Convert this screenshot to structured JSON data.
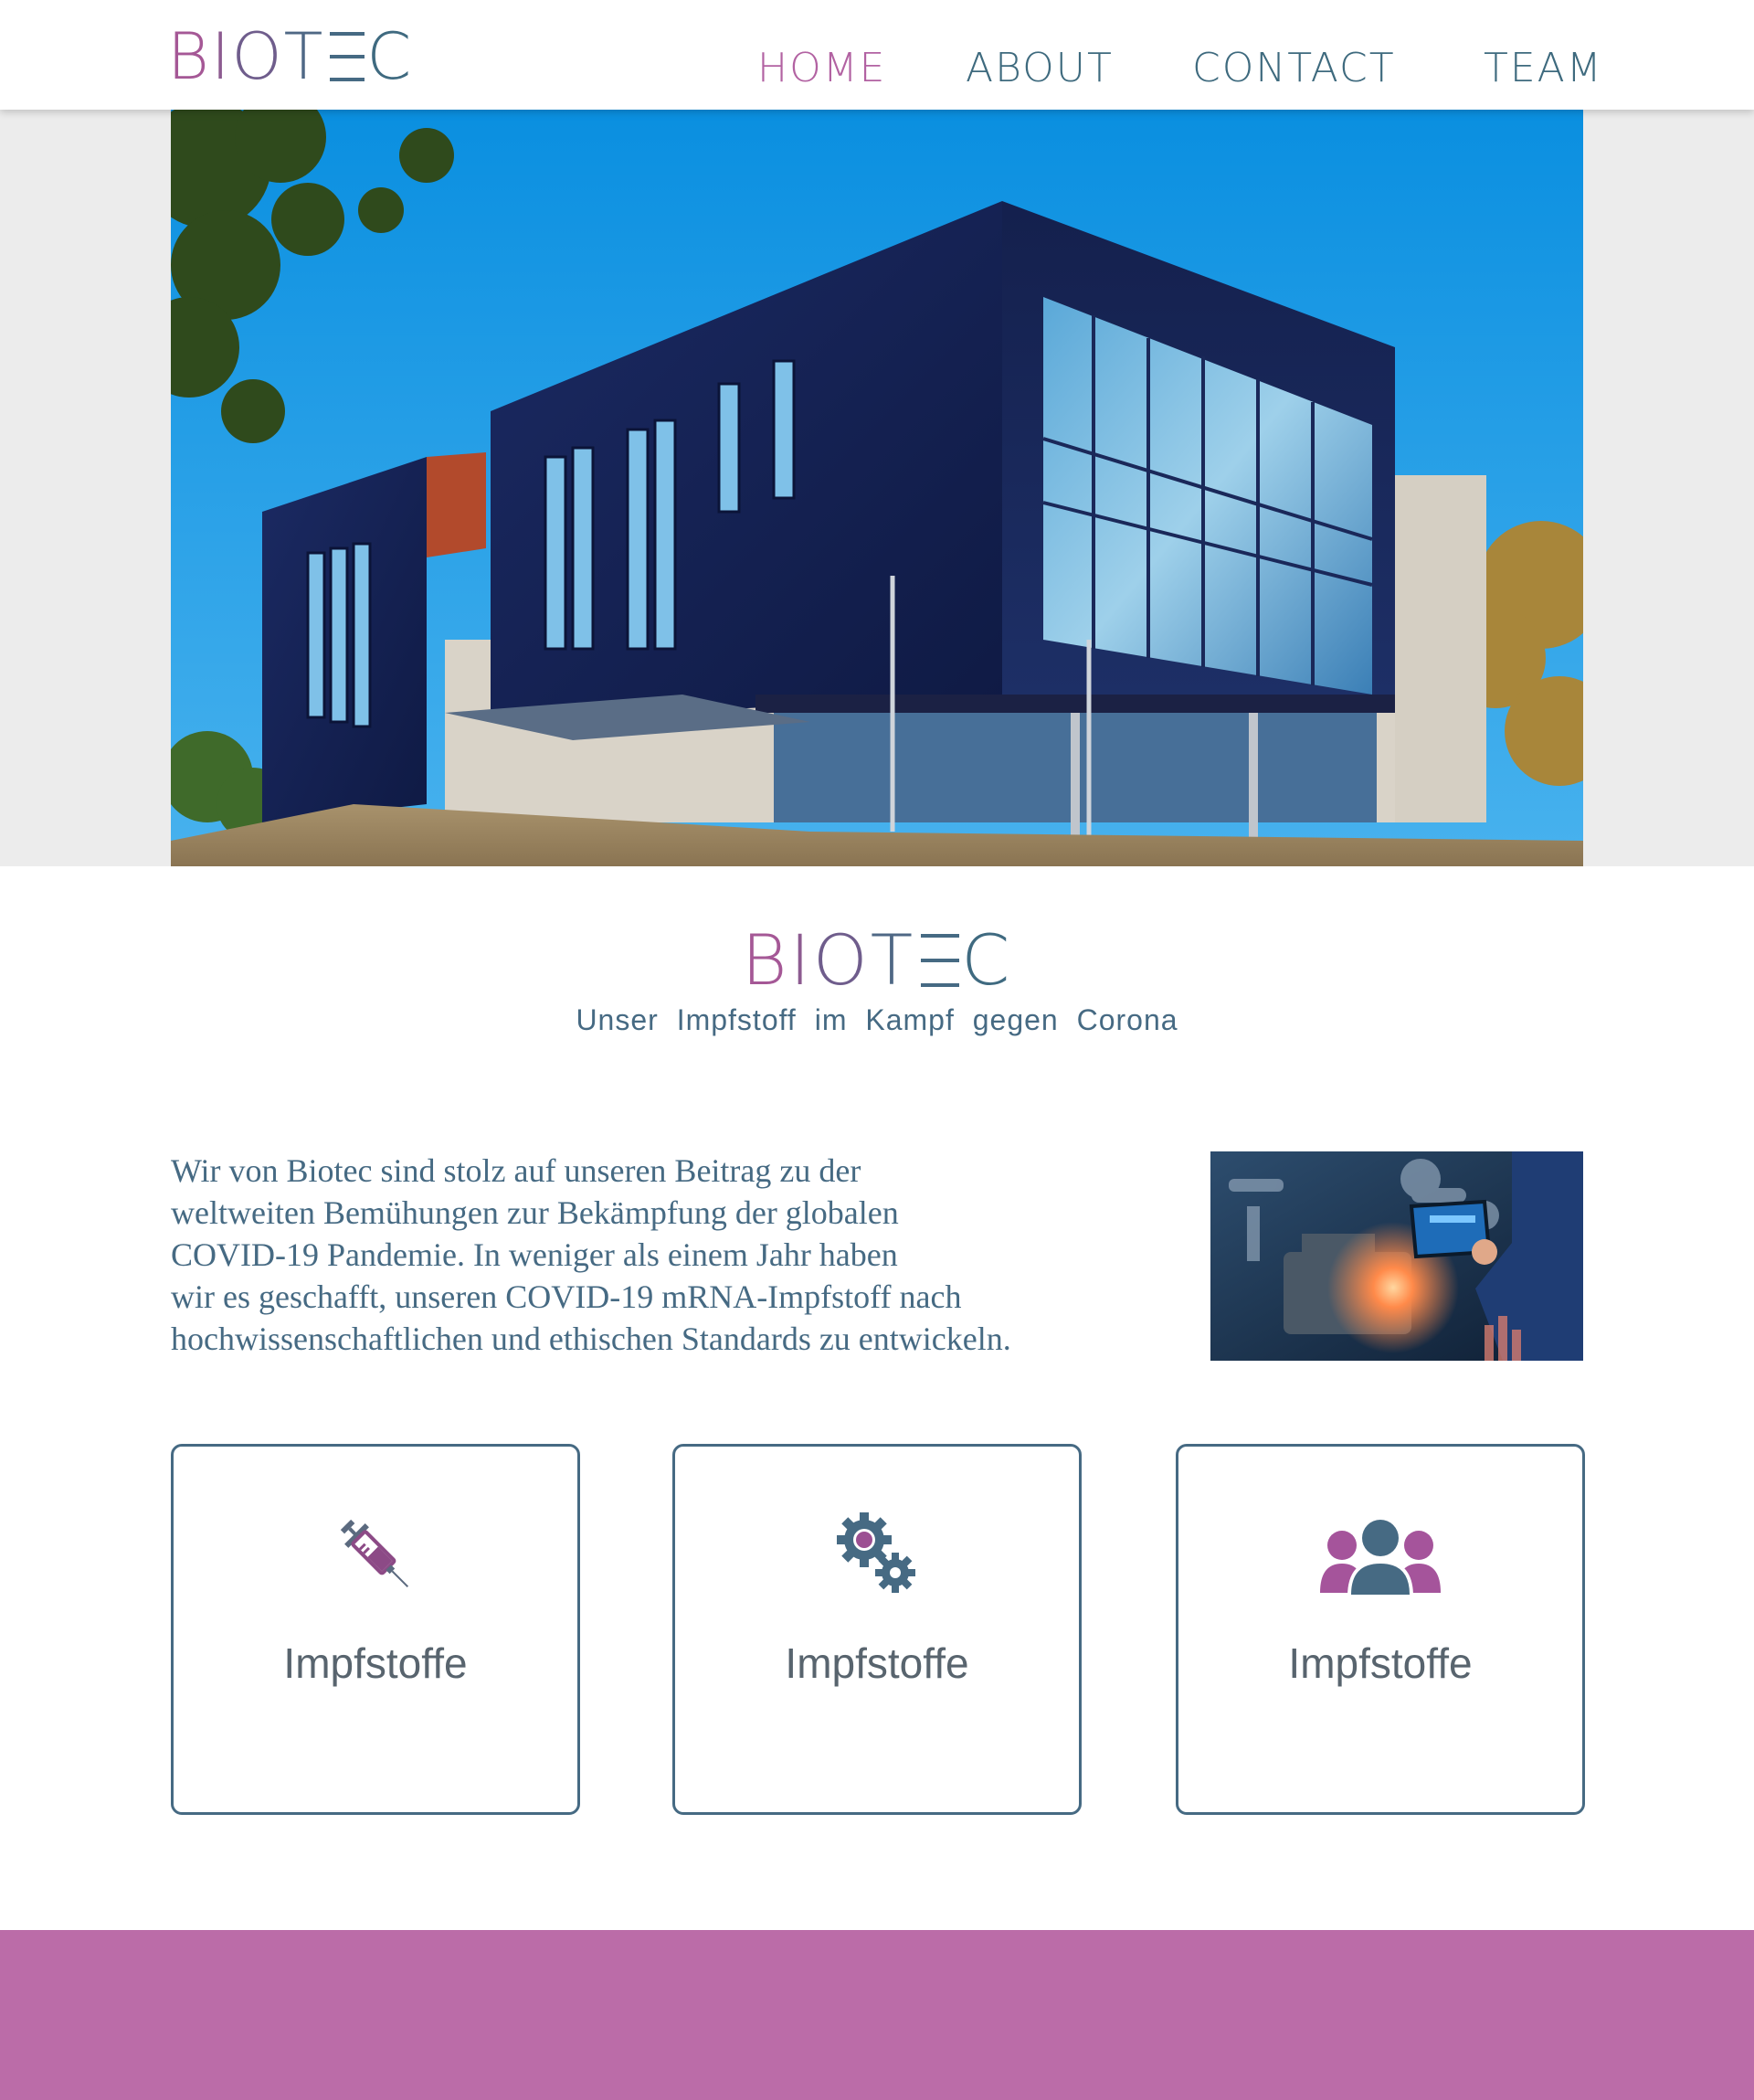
{
  "brand": {
    "letters": [
      "B",
      "I",
      "O",
      "T",
      "E",
      "C"
    ]
  },
  "nav": {
    "items": [
      {
        "label": "HOME",
        "active": true
      },
      {
        "label": "ABOUT",
        "active": false
      },
      {
        "label": "CONTACT",
        "active": false
      },
      {
        "label": "TEAM",
        "active": false
      }
    ]
  },
  "title_block": {
    "tagline": "Unser  Impfstoff  im  Kampf  gegen  Corona"
  },
  "intro": {
    "lines": [
      "Wir von Biotec sind stolz auf unseren Beitrag zu der",
      "weltweiten Bemühungen zur Bekämpfung der globalen",
      "COVID-19 Pandemie. In weniger als einem Jahr haben",
      "wir es geschafft, unseren COVID-19 mRNA-Impfstoff nach",
      "hochwissenschaftlichen und ethischen Standards zu entwickeln."
    ]
  },
  "cards": [
    {
      "label": "Impfstoffe",
      "icon": "syringe-icon"
    },
    {
      "label": "Impfstoffe",
      "icon": "gears-icon"
    },
    {
      "label": "Impfstoffe",
      "icon": "team-icon"
    }
  ],
  "colors": {
    "primary": "#466a83",
    "accent": "#b262a2",
    "footer": "#bb6ca8",
    "hero_band": "#ececec"
  }
}
